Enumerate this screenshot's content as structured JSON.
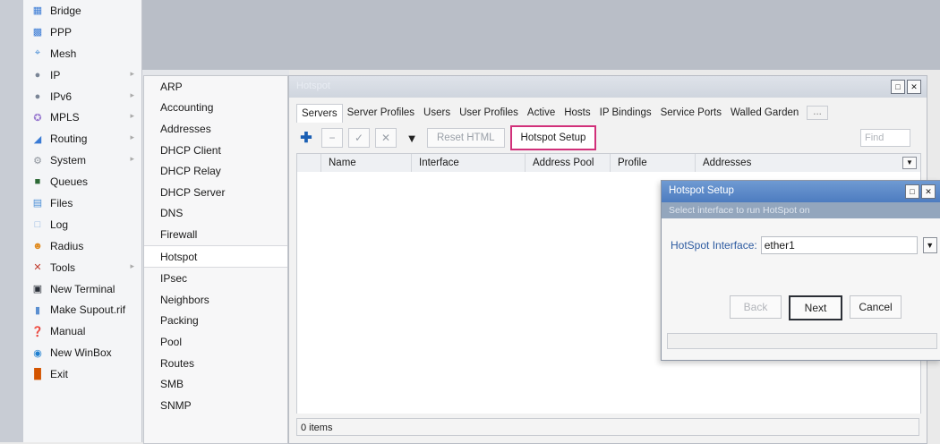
{
  "main_menu": {
    "items": [
      {
        "label": "Bridge",
        "icon": "bridge-icon",
        "has_submenu": false
      },
      {
        "label": "PPP",
        "icon": "ppp-icon",
        "has_submenu": false
      },
      {
        "label": "Mesh",
        "icon": "mesh-icon",
        "has_submenu": false
      },
      {
        "label": "IP",
        "icon": "ip-icon",
        "has_submenu": true
      },
      {
        "label": "IPv6",
        "icon": "ipv6-icon",
        "has_submenu": true
      },
      {
        "label": "MPLS",
        "icon": "mpls-icon",
        "has_submenu": true
      },
      {
        "label": "Routing",
        "icon": "routing-icon",
        "has_submenu": true
      },
      {
        "label": "System",
        "icon": "system-icon",
        "has_submenu": true
      },
      {
        "label": "Queues",
        "icon": "queues-icon",
        "has_submenu": false
      },
      {
        "label": "Files",
        "icon": "files-icon",
        "has_submenu": false
      },
      {
        "label": "Log",
        "icon": "log-icon",
        "has_submenu": false
      },
      {
        "label": "Radius",
        "icon": "radius-icon",
        "has_submenu": false
      },
      {
        "label": "Tools",
        "icon": "tools-icon",
        "has_submenu": true
      },
      {
        "label": "New Terminal",
        "icon": "terminal-icon",
        "has_submenu": false
      },
      {
        "label": "Make Supout.rif",
        "icon": "supout-icon",
        "has_submenu": false
      },
      {
        "label": "Manual",
        "icon": "manual-icon",
        "has_submenu": false
      },
      {
        "label": "New WinBox",
        "icon": "winbox-icon",
        "has_submenu": false
      },
      {
        "label": "Exit",
        "icon": "exit-icon",
        "has_submenu": false
      }
    ]
  },
  "ip_submenu": {
    "items": [
      "ARP",
      "Accounting",
      "Addresses",
      "DHCP Client",
      "DHCP Relay",
      "DHCP Server",
      "DNS",
      "Firewall",
      "Hotspot",
      "IPsec",
      "Neighbors",
      "Packing",
      "Pool",
      "Routes",
      "SMB",
      "SNMP"
    ],
    "selected": "Hotspot"
  },
  "hotspot_window": {
    "title": "Hotspot",
    "tabs": [
      "Servers",
      "Server Profiles",
      "Users",
      "User Profiles",
      "Active",
      "Hosts",
      "IP Bindings",
      "Service Ports",
      "Walled Garden",
      "..."
    ],
    "active_tab": "Servers",
    "toolbar": {
      "reset_html": "Reset HTML",
      "hotspot_setup": "Hotspot Setup",
      "find_placeholder": "Find"
    },
    "columns": [
      "Name",
      "Interface",
      "Address Pool",
      "Profile",
      "Addresses"
    ],
    "status": "0 items"
  },
  "setup_dialog": {
    "title": "Hotspot Setup",
    "subtitle": "Select interface to run HotSpot on",
    "interface_label": "HotSpot Interface:",
    "interface_value": "ether1",
    "buttons": {
      "back": "Back",
      "next": "Next",
      "cancel": "Cancel"
    }
  },
  "colors": {
    "highlight_border": "#d1307a",
    "dialog_title_bar": "#5b88c8",
    "label_blue": "#2c5aa0"
  }
}
